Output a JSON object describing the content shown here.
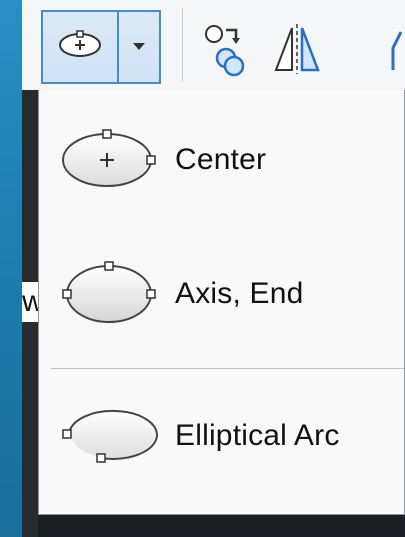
{
  "toolbar": {
    "ellipse_button": {
      "icon": "ellipse-center-icon"
    },
    "dropdown_arrow": {
      "icon": "dropdown-arrow-icon"
    },
    "tools": [
      {
        "icon": "copy-circle-icon"
      },
      {
        "icon": "mirror-icon"
      },
      {
        "icon": "partial-tool-icon"
      }
    ]
  },
  "edge_label": "w",
  "menu": {
    "items": [
      {
        "label": "Center",
        "icon": "ellipse-center-icon"
      },
      {
        "label": "Axis, End",
        "icon": "ellipse-axis-end-icon"
      },
      {
        "label": "Elliptical Arc",
        "icon": "elliptical-arc-icon"
      }
    ]
  }
}
